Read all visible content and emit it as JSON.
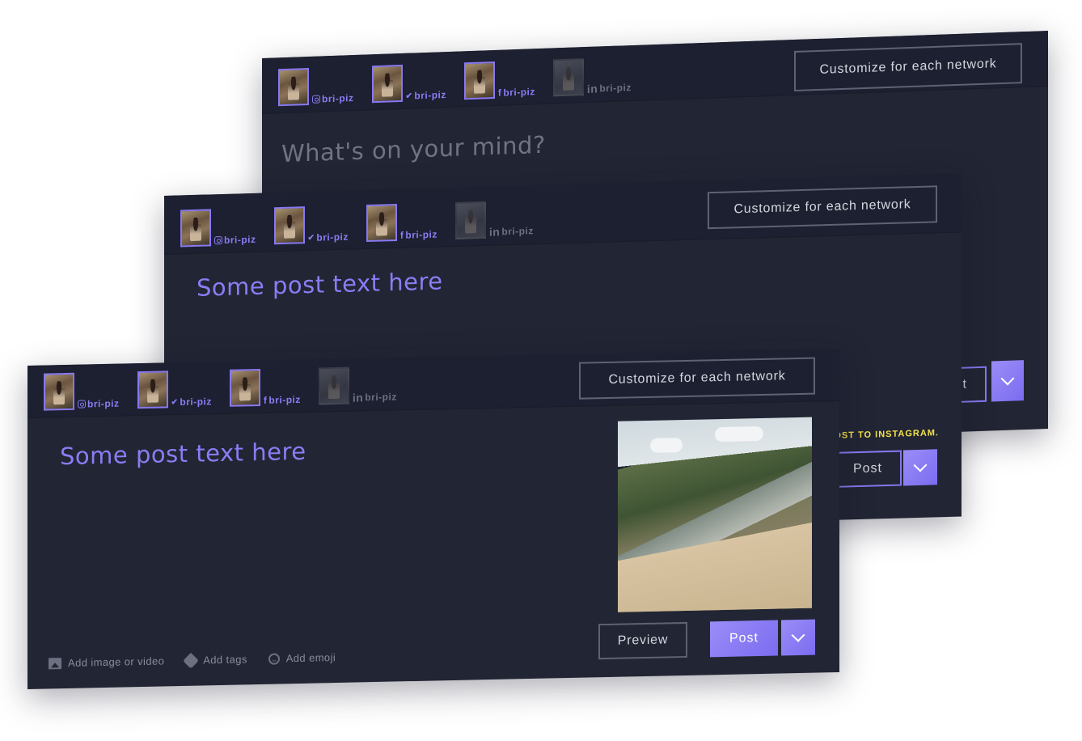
{
  "composers": [
    {
      "id": "back",
      "accounts": [
        {
          "network": "instagram",
          "icon": "instagram-icon",
          "handle": "bri-piz",
          "active": true
        },
        {
          "network": "twitter",
          "icon": "twitter-icon",
          "handle": "bri-piz",
          "active": true
        },
        {
          "network": "facebook",
          "icon": "facebook-icon",
          "handle": "bri-piz",
          "active": true
        },
        {
          "network": "linkedin",
          "icon": "linkedin-icon",
          "handle": "bri-piz",
          "active": false
        }
      ],
      "customize_label": "Customize for each network",
      "text": "What's on your mind?",
      "post_label": "Post"
    },
    {
      "id": "mid",
      "accounts": [
        {
          "network": "instagram",
          "icon": "instagram-icon",
          "handle": "bri-piz",
          "active": true
        },
        {
          "network": "twitter",
          "icon": "twitter-icon",
          "handle": "bri-piz",
          "active": true
        },
        {
          "network": "facebook",
          "icon": "facebook-icon",
          "handle": "bri-piz",
          "active": true
        },
        {
          "network": "linkedin",
          "icon": "linkedin-icon",
          "handle": "bri-piz",
          "active": false
        }
      ],
      "customize_label": "Customize for each network",
      "text": "Some post text here",
      "warning": "OST TO INSTAGRAM.",
      "post_label": "Post"
    },
    {
      "id": "front",
      "accounts": [
        {
          "network": "instagram",
          "icon": "instagram-icon",
          "handle": "bri-piz",
          "active": true
        },
        {
          "network": "twitter",
          "icon": "twitter-icon",
          "handle": "bri-piz",
          "active": true
        },
        {
          "network": "facebook",
          "icon": "facebook-icon",
          "handle": "bri-piz",
          "active": true
        },
        {
          "network": "linkedin",
          "icon": "linkedin-icon",
          "handle": "bri-piz",
          "active": false
        }
      ],
      "customize_label": "Customize for each network",
      "text": "Some post text here",
      "toolbar": {
        "add_media": "Add image or video",
        "add_tags": "Add tags",
        "add_emoji": "Add emoji"
      },
      "preview_label": "Preview",
      "post_label": "Post"
    }
  ],
  "colors": {
    "accent": "#8b7cf5",
    "card_bg": "#222533",
    "header_bg": "#1d2030",
    "warning": "#f2e24a"
  }
}
